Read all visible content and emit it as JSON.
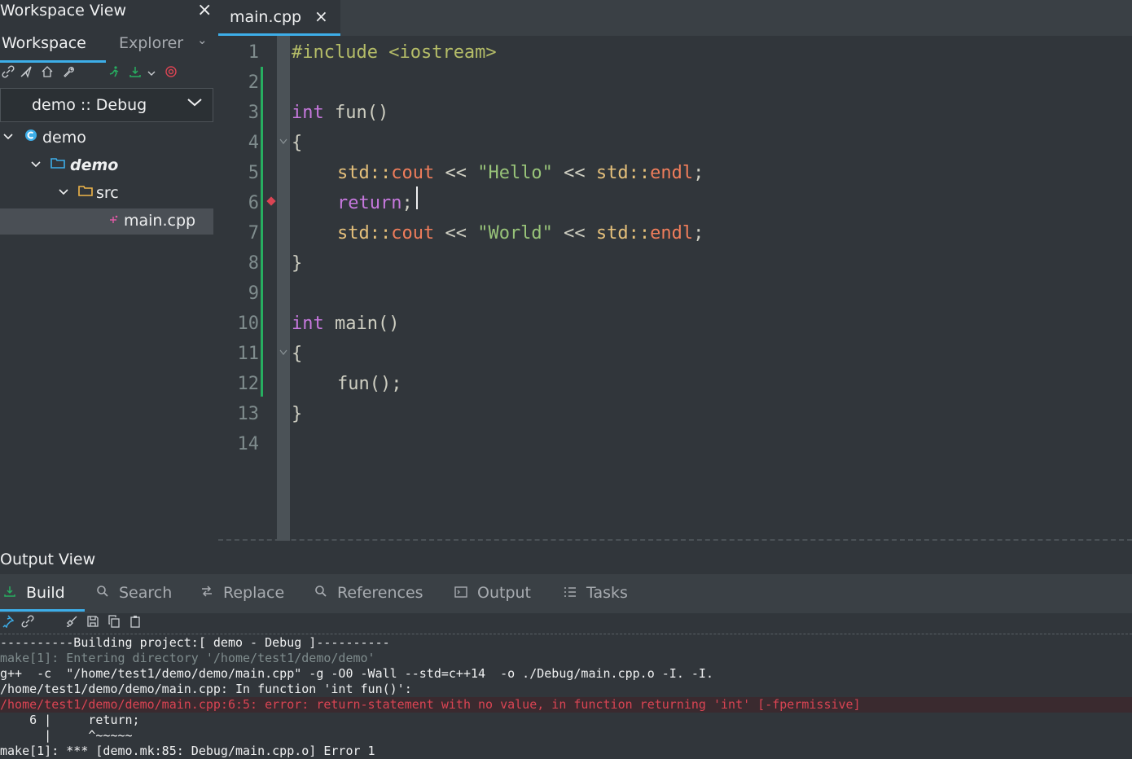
{
  "workspace_panel": {
    "title": "Workspace View",
    "close_icon": "×",
    "tabs": [
      {
        "label": "Workspace",
        "active": true
      },
      {
        "label": "Explorer",
        "active": false
      }
    ],
    "tabs_more_icon": "⌄",
    "toolbar_icons": [
      "link-icon",
      "send-icon",
      "home-icon",
      "wrench-icon",
      "run-icon",
      "build-icon",
      "stop-icon"
    ],
    "config_select": {
      "value": "demo :: Debug",
      "chevron": "⌄"
    },
    "tree": [
      {
        "label": "demo",
        "kind": "workspace",
        "expanded": true
      },
      {
        "label": "demo",
        "kind": "project",
        "expanded": true
      },
      {
        "label": "src",
        "kind": "folder",
        "expanded": true
      },
      {
        "label": "main.cpp",
        "kind": "file",
        "selected": true
      }
    ]
  },
  "editor": {
    "tab": {
      "label": "main.cpp",
      "close": "×"
    },
    "line_numbers": [
      "1",
      "2",
      "3",
      "4",
      "5",
      "6",
      "7",
      "8",
      "9",
      "10",
      "11",
      "12",
      "13",
      "14"
    ],
    "code": {
      "l1_directive": "#include",
      "l1_header": "<iostream>",
      "l3_type": "int",
      "l3_rest": " fun()",
      "l4": "{",
      "l5_ns": "std::",
      "l5_fn": "cout",
      "l5_op1": " << ",
      "l5_str": "\"Hello\"",
      "l5_op2": " << ",
      "l5_ns2": "std::",
      "l5_fn2": "endl",
      "l5_end": ";",
      "l6_kw": "return",
      "l6_end": ";",
      "l7_ns": "std::",
      "l7_fn": "cout",
      "l7_op1": " << ",
      "l7_str": "\"World\"",
      "l7_op2": " << ",
      "l7_ns2": "std::",
      "l7_fn2": "endl",
      "l7_end": ";",
      "l8": "}",
      "l10_type": "int",
      "l10_rest": " main()",
      "l11": "{",
      "l12": "fun();",
      "l13": "}"
    },
    "error_line": 6
  },
  "output_panel": {
    "title": "Output View",
    "tabs": [
      {
        "label": "Build",
        "icon": "download-icon",
        "active": true
      },
      {
        "label": "Search",
        "icon": "search-icon"
      },
      {
        "label": "Replace",
        "icon": "replace-icon"
      },
      {
        "label": "References",
        "icon": "search-icon"
      },
      {
        "label": "Output",
        "icon": "terminal-icon"
      },
      {
        "label": "Tasks",
        "icon": "list-icon"
      }
    ],
    "toolbar_icons": [
      "pin-icon",
      "link-icon",
      "clear-icon",
      "save-icon",
      "copy-icon",
      "paste-icon"
    ],
    "log": [
      {
        "text": "----------Building project:[ demo - Debug ]----------",
        "kind": "info"
      },
      {
        "text": "make[1]: Entering directory '/home/test1/demo/demo'",
        "kind": "dim"
      },
      {
        "text": "g++  -c  \"/home/test1/demo/demo/main.cpp\" -g -O0 -Wall --std=c++14  -o ./Debug/main.cpp.o -I. -I.",
        "kind": "info"
      },
      {
        "text": "/home/test1/demo/demo/main.cpp: In function 'int fun()':",
        "kind": "info"
      },
      {
        "text": "/home/test1/demo/demo/main.cpp:6:5: error: return-statement with no value, in function returning 'int' [-fpermissive]",
        "kind": "err"
      },
      {
        "text": "    6 |     return;",
        "kind": "info"
      },
      {
        "text": "      |     ^~~~~~",
        "kind": "info"
      },
      {
        "text": "make[1]: *** [demo.mk:85: Debug/main.cpp.o] Error 1",
        "kind": "info"
      }
    ]
  },
  "colors": {
    "accent": "#3daee9",
    "error": "#da4453",
    "change_bar": "#27ae60",
    "background": "#31363b"
  }
}
